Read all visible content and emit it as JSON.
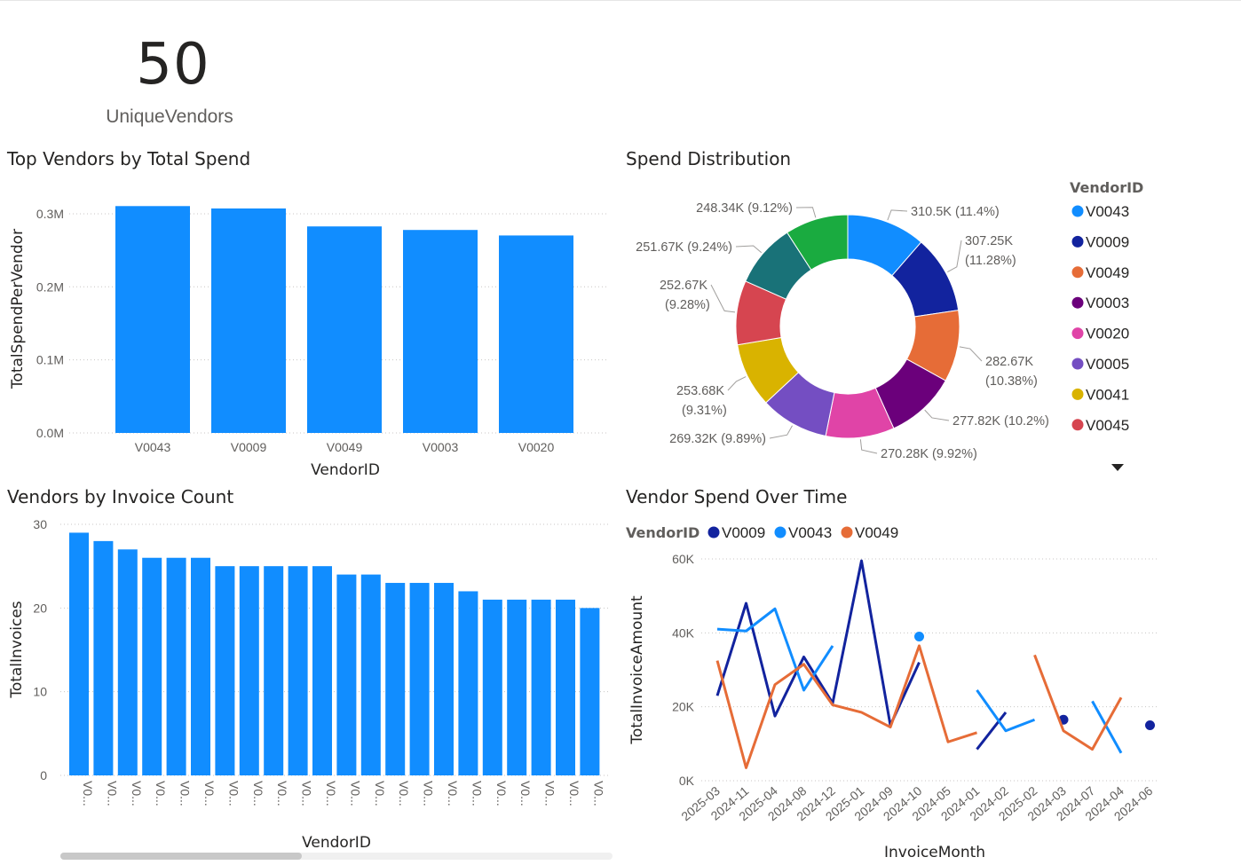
{
  "card": {
    "value": "50",
    "label": "UniqueVendors"
  },
  "titles": {
    "bar1": "Top Vendors by Total Spend",
    "donut": "Spend Distribution",
    "bar2": "Vendors by Invoice Count",
    "line": "Vendor Spend Over Time"
  },
  "colors": {
    "V0043": "#118DFF",
    "V0009": "#12239E",
    "V0049": "#E66C37",
    "V0003": "#6B007B",
    "V0020": "#E044A7",
    "V0005": "#744EC2",
    "V0041": "#D9B300",
    "V0045": "#D64550",
    "teal": "#197278",
    "green": "#1AAB40"
  },
  "chart_data": [
    {
      "type": "bar",
      "title": "Top Vendors by Total Spend",
      "categories": [
        "V0043",
        "V0009",
        "V0049",
        "V0003",
        "V0020"
      ],
      "values": [
        310500,
        307250,
        282670,
        277820,
        270280
      ],
      "xlabel": "VendorID",
      "ylabel": "TotalSpendPerVendor",
      "yticks": [
        "0.0M",
        "0.1M",
        "0.2M",
        "0.3M"
      ],
      "ylim": [
        0,
        340000
      ],
      "grid": true
    },
    {
      "type": "pie",
      "title": "Spend Distribution",
      "legend_title": "VendorID",
      "legend_placement": "right",
      "legend": [
        "V0043",
        "V0009",
        "V0049",
        "V0003",
        "V0020",
        "V0005",
        "V0041",
        "V0045"
      ],
      "slices": [
        {
          "value": 310500,
          "label_a": "310.5K (11.4%)",
          "label_b": ""
        },
        {
          "value": 307250,
          "label_a": "307.25K",
          "label_b": "(11.28%)"
        },
        {
          "value": 282670,
          "label_a": "282.67K",
          "label_b": "(10.38%)"
        },
        {
          "value": 277820,
          "label_a": "277.82K (10.2%)",
          "label_b": ""
        },
        {
          "value": 270280,
          "label_a": "270.28K (9.92%)",
          "label_b": ""
        },
        {
          "value": 269320,
          "label_a": "269.32K (9.89%)",
          "label_b": ""
        },
        {
          "value": 253680,
          "label_a": "253.68K",
          "label_b": "(9.31%)"
        },
        {
          "value": 252670,
          "label_a": "252.67K",
          "label_b": "(9.28%)"
        },
        {
          "value": 251670,
          "label_a": "251.67K (9.24%)",
          "label_b": ""
        },
        {
          "value": 248340,
          "label_a": "248.34K (9.12%)",
          "label_b": ""
        }
      ]
    },
    {
      "type": "bar",
      "title": "Vendors by Invoice Count",
      "values": [
        29,
        28,
        27,
        26,
        26,
        26,
        25,
        25,
        25,
        25,
        25,
        24,
        24,
        23,
        23,
        23,
        22,
        21,
        21,
        21,
        21,
        20
      ],
      "category_label": "V0...",
      "xlabel": "VendorID",
      "ylabel": "TotalInvoices",
      "yticks": [
        "0",
        "10",
        "20",
        "30"
      ],
      "ylim": [
        0,
        30
      ],
      "grid": true
    },
    {
      "type": "line",
      "title": "Vendor Spend Over Time",
      "legend_title": "VendorID",
      "legend_placement": "top-left",
      "x": [
        "2025-03",
        "2024-11",
        "2025-04",
        "2024-08",
        "2024-12",
        "2025-01",
        "2024-09",
        "2024-10",
        "2024-05",
        "2024-01",
        "2024-02",
        "2025-02",
        "2024-03",
        "2024-07",
        "2024-04",
        "2024-06"
      ],
      "xlabel": "InvoiceMonth",
      "ylabel": "TotalInvoiceAmount",
      "yticks": [
        "0K",
        "20K",
        "40K",
        "60K"
      ],
      "ylim": [
        0,
        60000
      ],
      "grid": true,
      "series": [
        {
          "name": "V0009",
          "values": [
            23000,
            48000,
            17500,
            33500,
            21000,
            59500,
            15000,
            32000,
            null,
            8500,
            18500,
            null,
            16500,
            null,
            null,
            15000
          ]
        },
        {
          "name": "V0043",
          "values": [
            41000,
            40500,
            46500,
            24500,
            36500,
            null,
            null,
            39000,
            null,
            24500,
            13500,
            16500,
            null,
            21500,
            7500,
            null
          ]
        },
        {
          "name": "V0049",
          "values": [
            32500,
            3500,
            26000,
            31500,
            20500,
            18500,
            14500,
            36500,
            10500,
            13000,
            null,
            34000,
            13500,
            8500,
            22500,
            null
          ]
        }
      ]
    }
  ]
}
